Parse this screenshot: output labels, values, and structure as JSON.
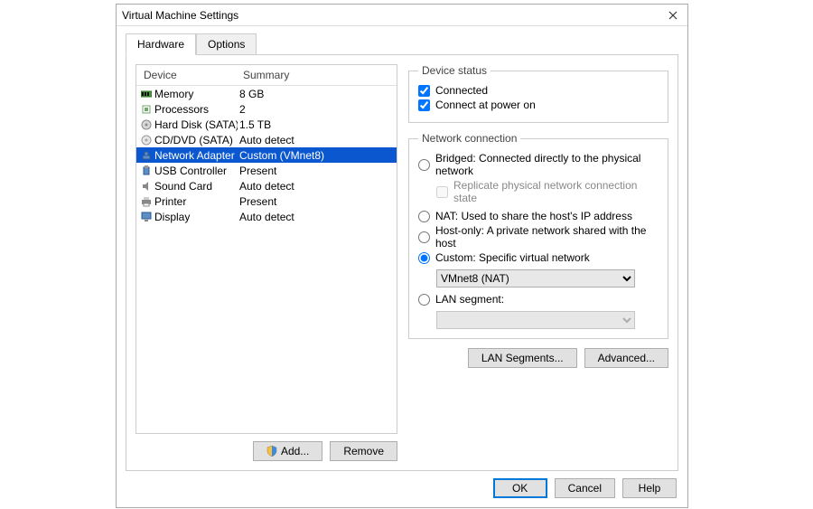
{
  "window": {
    "title": "Virtual Machine Settings"
  },
  "tabs": {
    "hardware": "Hardware",
    "options": "Options",
    "active": "hardware"
  },
  "list": {
    "headers": {
      "device": "Device",
      "summary": "Summary"
    },
    "items": [
      {
        "icon": "memory-icon",
        "name": "Memory",
        "summary": "8 GB"
      },
      {
        "icon": "cpu-icon",
        "name": "Processors",
        "summary": "2"
      },
      {
        "icon": "disk-icon",
        "name": "Hard Disk (SATA)",
        "summary": "1.5 TB"
      },
      {
        "icon": "cd-icon",
        "name": "CD/DVD (SATA)",
        "summary": "Auto detect"
      },
      {
        "icon": "network-icon",
        "name": "Network Adapter",
        "summary": "Custom (VMnet8)",
        "selected": true
      },
      {
        "icon": "usb-icon",
        "name": "USB Controller",
        "summary": "Present"
      },
      {
        "icon": "sound-icon",
        "name": "Sound Card",
        "summary": "Auto detect"
      },
      {
        "icon": "printer-icon",
        "name": "Printer",
        "summary": "Present"
      },
      {
        "icon": "display-icon",
        "name": "Display",
        "summary": "Auto detect"
      }
    ]
  },
  "buttons": {
    "add": "Add...",
    "remove": "Remove",
    "lan": "LAN Segments...",
    "advanced": "Advanced...",
    "ok": "OK",
    "cancel": "Cancel",
    "help": "Help"
  },
  "deviceStatus": {
    "legend": "Device status",
    "connected": {
      "label": "Connected",
      "checked": true
    },
    "connectPower": {
      "label": "Connect at power on",
      "checked": true
    }
  },
  "netConn": {
    "legend": "Network connection",
    "bridged": "Bridged: Connected directly to the physical network",
    "replicate": "Replicate physical network connection state",
    "nat": "NAT: Used to share the host's IP address",
    "hostonly": "Host-only: A private network shared with the host",
    "custom": "Custom: Specific virtual network",
    "customSelect": "VMnet8 (NAT)",
    "lanseg": "LAN segment:",
    "selected": "custom"
  }
}
